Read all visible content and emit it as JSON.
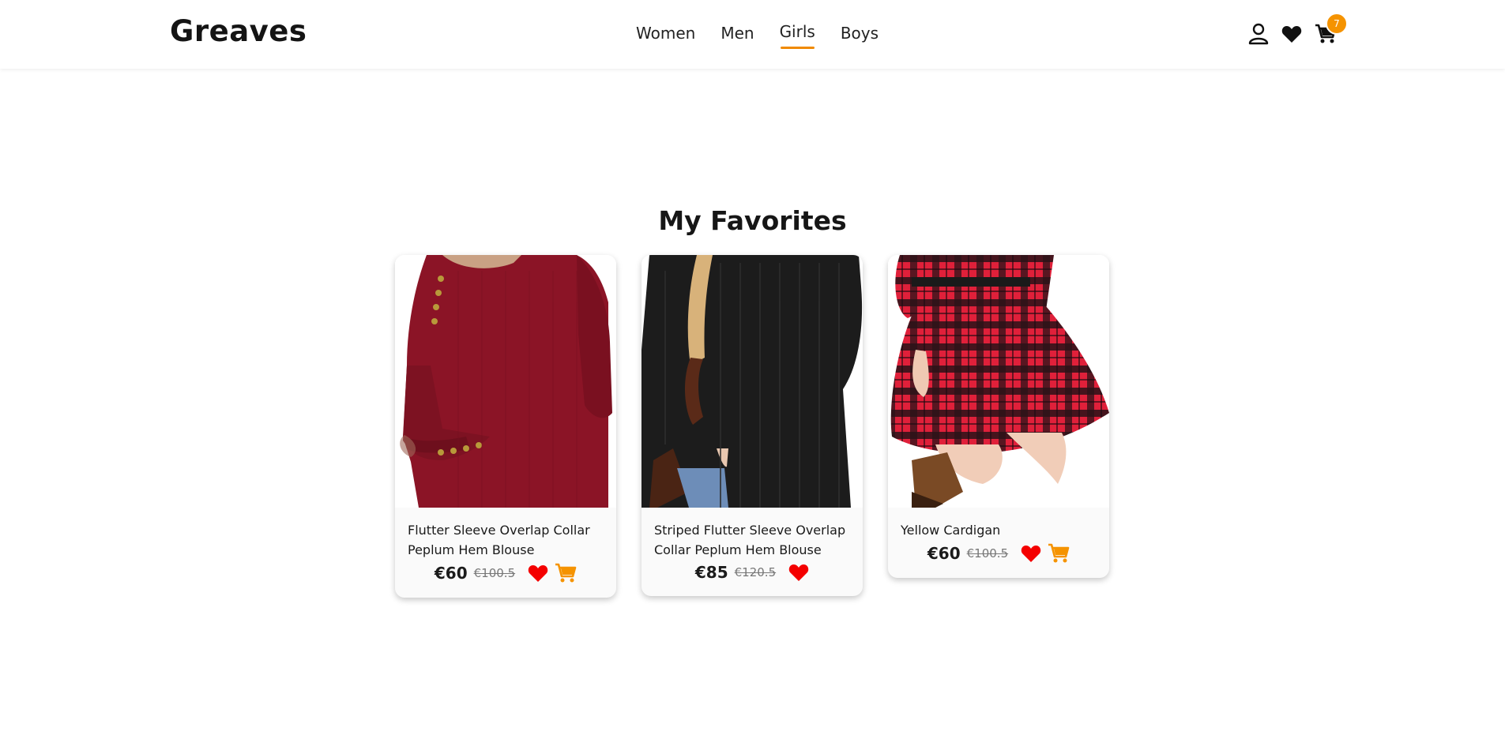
{
  "header": {
    "logo": "Greaves",
    "nav": [
      {
        "label": "Women"
      },
      {
        "label": "Men"
      },
      {
        "label": "Girls"
      },
      {
        "label": "Boys"
      }
    ],
    "cart_count": "7",
    "accent_color": "#f08a00"
  },
  "page": {
    "title": "My Favorites"
  },
  "favorites": [
    {
      "name": "Flutter Sleeve Overlap Collar Peplum Hem Blouse",
      "price": "€60",
      "old_price": "€100.5"
    },
    {
      "name": "Striped Flutter Sleeve Overlap Collar Peplum Hem Blouse",
      "price": "€85",
      "old_price": "€120.5"
    },
    {
      "name": "Yellow Cardigan",
      "price": "€60",
      "old_price": "€100.5"
    }
  ],
  "icons": [
    "ireland-flag-icon",
    "user-icon",
    "heart-icon",
    "cart-icon"
  ]
}
